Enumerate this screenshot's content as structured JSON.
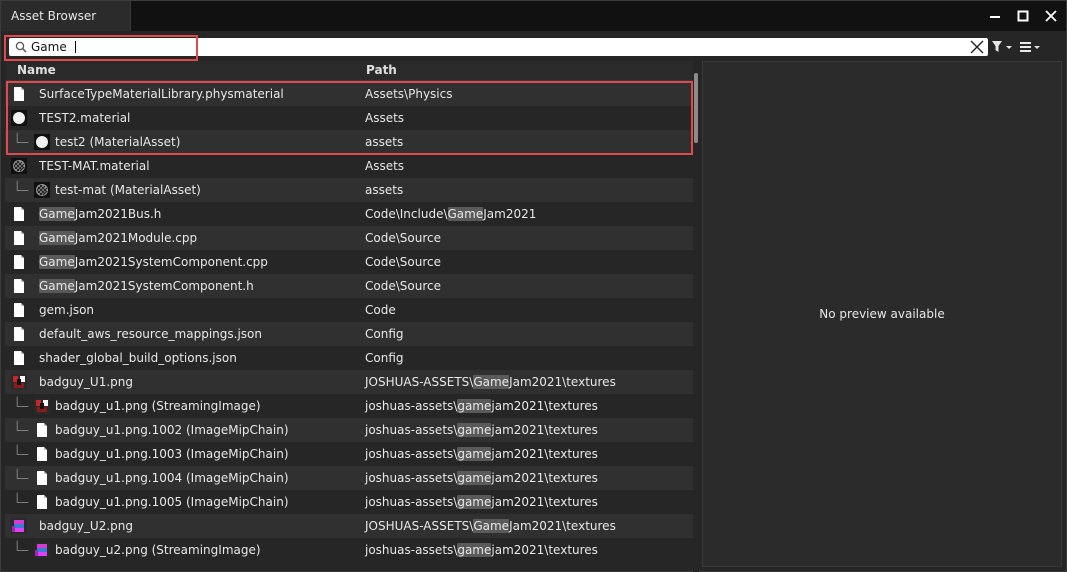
{
  "window": {
    "title": "Asset Browser",
    "controls": [
      "minimize",
      "maximize",
      "close"
    ]
  },
  "search": {
    "value": "Game",
    "placeholder": ""
  },
  "columns": {
    "name": "Name",
    "path": "Path"
  },
  "rows": [
    {
      "icon": "file-icon",
      "depth": 0,
      "name": [
        "SurfaceTypeMaterialLibrary.physmaterial"
      ],
      "path": [
        "Assets\\Physics"
      ]
    },
    {
      "icon": "material-sphere-icon",
      "depth": 0,
      "name": [
        "TEST2.material"
      ],
      "path": [
        "Assets"
      ]
    },
    {
      "icon": "material-sphere-icon",
      "depth": 1,
      "name": [
        "test2 (MaterialAsset)"
      ],
      "path": [
        "assets"
      ]
    },
    {
      "icon": "material-pattern-icon",
      "depth": 0,
      "name": [
        "TEST-MAT.material"
      ],
      "path": [
        "Assets"
      ]
    },
    {
      "icon": "material-pattern-icon",
      "depth": 1,
      "name": [
        "test-mat (MaterialAsset)"
      ],
      "path": [
        "assets"
      ]
    },
    {
      "icon": "file-icon",
      "depth": 0,
      "name": [
        "",
        "Game",
        "Jam2021Bus.h"
      ],
      "path": [
        "Code\\Include\\",
        "Game",
        "Jam2021"
      ]
    },
    {
      "icon": "file-icon",
      "depth": 0,
      "name": [
        "",
        "Game",
        "Jam2021Module.cpp"
      ],
      "path": [
        "Code\\Source"
      ]
    },
    {
      "icon": "file-icon",
      "depth": 0,
      "name": [
        "",
        "Game",
        "Jam2021SystemComponent.cpp"
      ],
      "path": [
        "Code\\Source"
      ]
    },
    {
      "icon": "file-icon",
      "depth": 0,
      "name": [
        "",
        "Game",
        "Jam2021SystemComponent.h"
      ],
      "path": [
        "Code\\Source"
      ]
    },
    {
      "icon": "file-icon",
      "depth": 0,
      "name": [
        "gem.json"
      ],
      "path": [
        "Code"
      ]
    },
    {
      "icon": "file-icon",
      "depth": 0,
      "name": [
        "default_aws_resource_mappings.json"
      ],
      "path": [
        "Config"
      ]
    },
    {
      "icon": "file-icon",
      "depth": 0,
      "name": [
        "shader_global_build_options.json"
      ],
      "path": [
        "Config"
      ]
    },
    {
      "icon": "image-red-icon",
      "depth": 0,
      "name": [
        "badguy_U1.png"
      ],
      "path": [
        "JOSHUAS-ASSETS\\",
        "Game",
        "Jam2021\\textures"
      ]
    },
    {
      "icon": "image-red-icon",
      "depth": 1,
      "name": [
        "badguy_u1.png (StreamingImage)"
      ],
      "path": [
        "joshuas-assets\\",
        "game",
        "jam2021\\textures"
      ]
    },
    {
      "icon": "file-icon",
      "depth": 1,
      "name": [
        "badguy_u1.png.1002 (ImageMipChain)"
      ],
      "path": [
        "joshuas-assets\\",
        "game",
        "jam2021\\textures"
      ]
    },
    {
      "icon": "file-icon",
      "depth": 1,
      "name": [
        "badguy_u1.png.1003 (ImageMipChain)"
      ],
      "path": [
        "joshuas-assets\\",
        "game",
        "jam2021\\textures"
      ]
    },
    {
      "icon": "file-icon",
      "depth": 1,
      "name": [
        "badguy_u1.png.1004 (ImageMipChain)"
      ],
      "path": [
        "joshuas-assets\\",
        "game",
        "jam2021\\textures"
      ]
    },
    {
      "icon": "file-icon",
      "depth": 1,
      "name": [
        "badguy_u1.png.1005 (ImageMipChain)"
      ],
      "path": [
        "joshuas-assets\\",
        "game",
        "jam2021\\textures"
      ]
    },
    {
      "icon": "image-color-icon",
      "depth": 0,
      "name": [
        "badguy_U2.png"
      ],
      "path": [
        "JOSHUAS-ASSETS\\",
        "Game",
        "Jam2021\\textures"
      ]
    },
    {
      "icon": "image-color-icon",
      "depth": 1,
      "name": [
        "badguy_u2.png (StreamingImage)"
      ],
      "path": [
        "joshuas-assets\\",
        "game",
        "jam2021\\textures"
      ]
    }
  ],
  "preview": {
    "message": "No preview available"
  },
  "colors": {
    "highlight": "#e04a4a",
    "match": "#5a5a5a"
  }
}
